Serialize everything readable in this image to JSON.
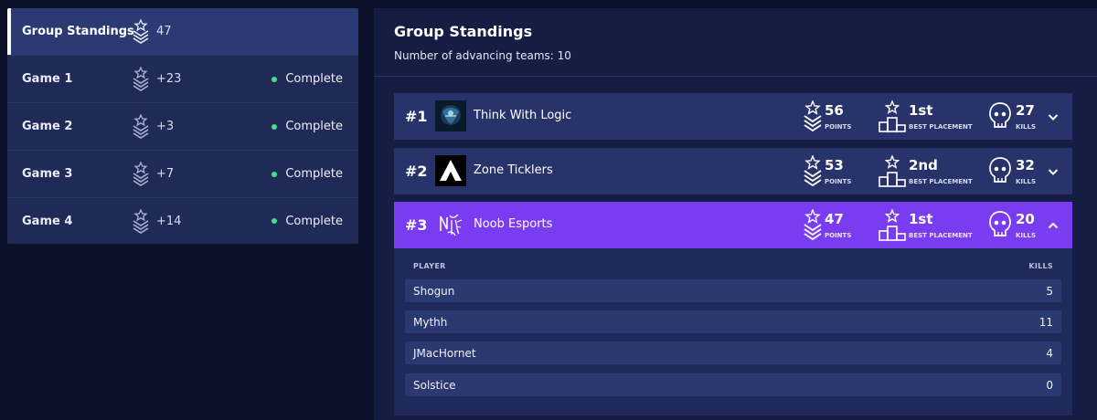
{
  "sidebar": {
    "items": [
      {
        "name": "Group Standings",
        "points": "47",
        "status": ""
      },
      {
        "name": "Game 1",
        "points": "+23",
        "status": "Complete"
      },
      {
        "name": "Game 2",
        "points": "+3",
        "status": "Complete"
      },
      {
        "name": "Game 3",
        "points": "+7",
        "status": "Complete"
      },
      {
        "name": "Game 4",
        "points": "+14",
        "status": "Complete"
      }
    ]
  },
  "main": {
    "title": "Group Standings",
    "subtitle": "Number of advancing teams: 10",
    "teams": [
      {
        "rank": "#1",
        "name": "Think With Logic",
        "points": "56",
        "points_label": "POINTS",
        "placement": "1st",
        "placement_label": "BEST PLACEMENT",
        "kills": "27",
        "kills_label": "KILLS"
      },
      {
        "rank": "#2",
        "name": "Zone Ticklers",
        "points": "53",
        "points_label": "POINTS",
        "placement": "2nd",
        "placement_label": "BEST PLACEMENT",
        "kills": "32",
        "kills_label": "KILLS"
      },
      {
        "rank": "#3",
        "name": "Noob Esports",
        "points": "47",
        "points_label": "POINTS",
        "placement": "1st",
        "placement_label": "BEST PLACEMENT",
        "kills": "20",
        "kills_label": "KILLS"
      }
    ],
    "players_table": {
      "header_player": "PLAYER",
      "header_kills": "KILLS",
      "rows": [
        {
          "player": "Shogun",
          "kills": "5"
        },
        {
          "player": "Mythh",
          "kills": "11"
        },
        {
          "player": "JMacHornet",
          "kills": "4"
        },
        {
          "player": "Solstice",
          "kills": "0"
        }
      ]
    }
  },
  "colors": {
    "background": "#0b1129",
    "sidebar": "#1f2a57",
    "sidebar_active": "#2c3a74",
    "team_row": "#27336a",
    "team_row_expanded": "#7a3cf0",
    "status_dot": "#3ee38f"
  },
  "icons": {
    "points": "chevron-rank-star-icon",
    "placement": "podium-star-icon",
    "kills": "skull-icon",
    "expand": "chevron-down-icon",
    "collapse": "chevron-up-icon"
  }
}
